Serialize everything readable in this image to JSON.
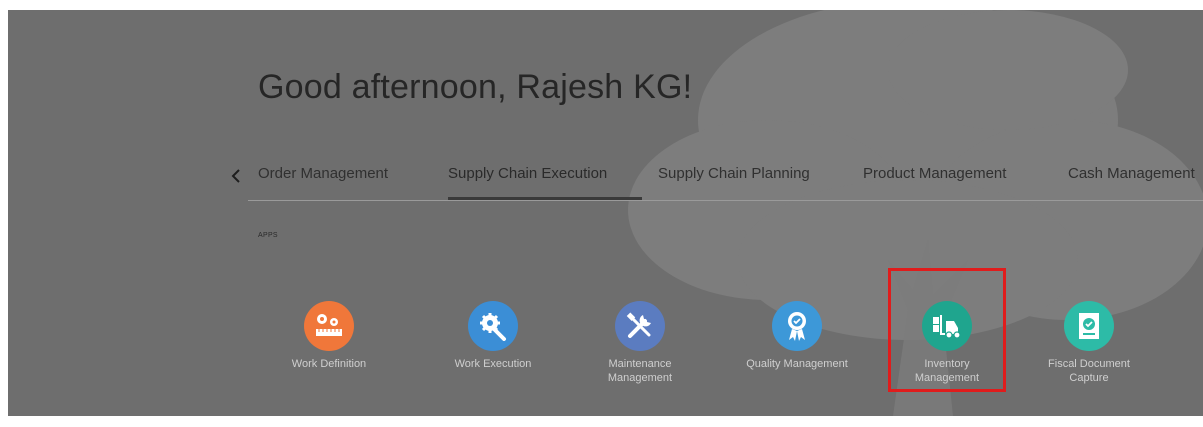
{
  "greeting": "Good afternoon, Rajesh KG!",
  "tabs": [
    {
      "label": "Order Management"
    },
    {
      "label": "Supply Chain Execution"
    },
    {
      "label": "Supply Chain Planning"
    },
    {
      "label": "Product Management"
    },
    {
      "label": "Cash Management"
    }
  ],
  "active_tab": "Supply Chain Execution",
  "section_label": "APPS",
  "apps": [
    {
      "label": "Work Definition",
      "icon": "work-definition-icon",
      "color": "#f0773a"
    },
    {
      "label": "Work Execution",
      "icon": "work-execution-icon",
      "color": "#3b8ed6"
    },
    {
      "label": "Maintenance Management",
      "icon": "maintenance-icon",
      "color": "#5b7cc0"
    },
    {
      "label": "Quality Management",
      "icon": "quality-icon",
      "color": "#3d98d8"
    },
    {
      "label": "Inventory Management",
      "icon": "forklift-icon",
      "color": "#1fa58e"
    },
    {
      "label": "Fiscal Document Capture",
      "icon": "fiscal-document-icon",
      "color": "#2dbba7"
    }
  ],
  "highlight_color": "#e01c1c",
  "highlighted_app": "Inventory Management"
}
